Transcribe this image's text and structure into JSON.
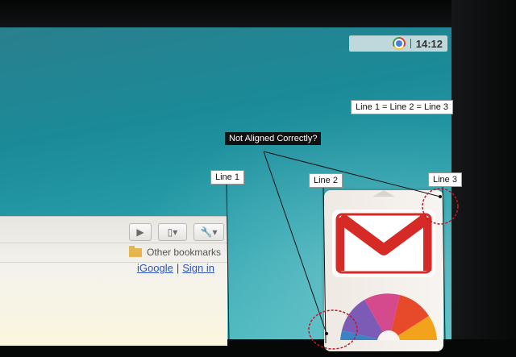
{
  "system_tray": {
    "browser_icon": "chrome-icon",
    "clock": "14:12"
  },
  "browser": {
    "toolbar": {
      "go_icon": "play-arrow-icon",
      "page_menu_icon": "page-menu-icon",
      "wrench_icon": "wrench-icon"
    },
    "bookmarks_bar": {
      "folder_icon": "folder-icon",
      "other_bookmarks_label": "Other bookmarks"
    },
    "links": {
      "igoogle": "iGoogle",
      "separator": "|",
      "sign_in": "Sign in"
    }
  },
  "launcher": {
    "scroll_up_icon": "chevron-up-icon",
    "apps": [
      {
        "icon": "gmail-icon"
      },
      {
        "icon": "picasa-icon"
      }
    ]
  },
  "annotations": {
    "equality_note": "Line 1 = Line 2 = Line 3",
    "question": "Not Aligned Correctly?",
    "line1": "Line 1",
    "line2": "Line 2",
    "line3": "Line 3"
  },
  "colors": {
    "desktop_teal": "#1b8a98",
    "annotation_circle": "#c0172a",
    "link_blue": "#2f55b5",
    "gmail_red": "#d62a26"
  }
}
